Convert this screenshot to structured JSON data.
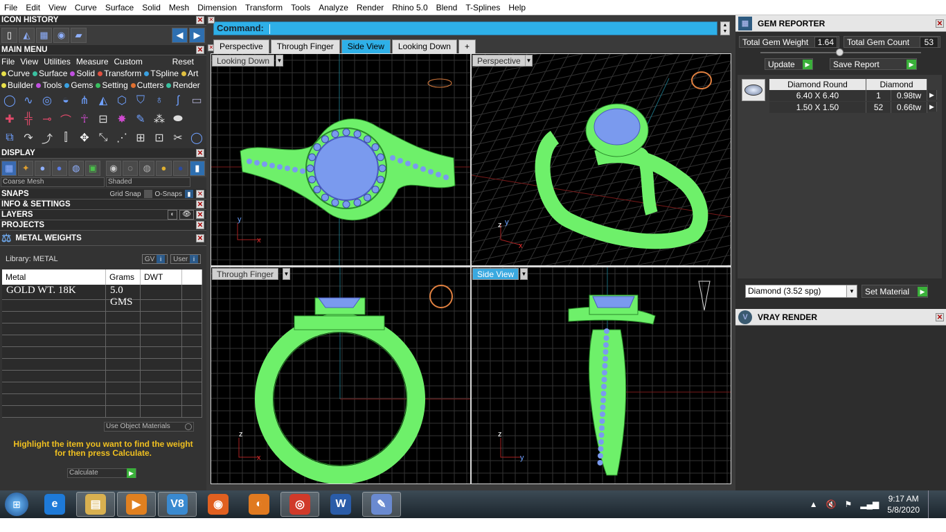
{
  "menubar": [
    "File",
    "Edit",
    "View",
    "Curve",
    "Surface",
    "Solid",
    "Mesh",
    "Dimension",
    "Transform",
    "Tools",
    "Analyze",
    "Render",
    "Rhino 5.0",
    "Blend",
    "T-Splines",
    "Help"
  ],
  "left": {
    "icon_history_title": "ICON HISTORY",
    "main_menu_title": "MAIN MENU",
    "main_menu_items": [
      "File",
      "View",
      "Utilities",
      "Measure",
      "Custom"
    ],
    "reset_label": "Reset",
    "categories_row1": [
      {
        "label": "Curve",
        "color": "#e8e04a"
      },
      {
        "label": "Surface",
        "color": "#3ac0a0"
      },
      {
        "label": "Solid",
        "color": "#c050e0"
      },
      {
        "label": "Transform",
        "color": "#e05040"
      },
      {
        "label": "TSpline",
        "color": "#3aa0e0"
      },
      {
        "label": "Art",
        "color": "#e0c040"
      }
    ],
    "categories_row2": [
      {
        "label": "Builder",
        "color": "#e8e04a"
      },
      {
        "label": "Tools",
        "color": "#c050e0"
      },
      {
        "label": "Gems",
        "color": "#3aa0e0"
      },
      {
        "label": "Setting",
        "color": "#3ac060"
      },
      {
        "label": "Cutters",
        "color": "#e07030"
      },
      {
        "label": "Render",
        "color": "#3ac0a0"
      }
    ],
    "display_title": "DISPLAY",
    "mesh_select": "Coarse Mesh",
    "shade_select": "Shaded",
    "snaps_title": "SNAPS",
    "grid_snap": "Grid Snap",
    "o_snaps": "O-Snaps",
    "info_title": "INFO & SETTINGS",
    "layers_title": "LAYERS",
    "projects_title": "PROJECTS",
    "metal_weights_title": "METAL WEIGHTS",
    "library_label": "Library: METAL",
    "gv_label": "GV",
    "user_label": "User",
    "table_headers": [
      "Metal",
      "Grams",
      "DWT"
    ],
    "rows": [
      {
        "metal": "GOLD WT. 18K",
        "grams": "5.0 GMS",
        "dwt": ""
      }
    ],
    "use_object_materials": "Use Object Materials",
    "hint": "Highlight the item you want to find the weight for then press Calculate.",
    "calculate_label": "Calculate"
  },
  "center": {
    "command_label": "Command:",
    "tabs": [
      "Perspective",
      "Through Finger",
      "Side View",
      "Looking Down"
    ],
    "active_tab": "Side View",
    "add_tab": "+",
    "viewports": {
      "top_left": "Looking Down",
      "top_right": "Perspective",
      "bottom_left": "Through Finger",
      "bottom_right": "Side View"
    },
    "axis_labels": {
      "tl": [
        "y",
        "x"
      ],
      "tr": [
        "z",
        "y",
        "x"
      ],
      "bl": [
        "z",
        "x"
      ],
      "br": [
        "z",
        "y"
      ]
    }
  },
  "right": {
    "gem_reporter_title": "GEM REPORTER",
    "total_gem_weight_label": "Total Gem Weight",
    "total_gem_weight": "1.64",
    "total_gem_count_label": "Total Gem Count",
    "total_gem_count": "53",
    "update_label": "Update",
    "save_report_label": "Save Report",
    "gem_headers": [
      "Diamond Round",
      "Diamond"
    ],
    "gems": [
      {
        "size": "6.40 X 6.40",
        "count": "1",
        "weight": "0.98tw"
      },
      {
        "size": "1.50 X 1.50",
        "count": "52",
        "weight": "0.66tw"
      }
    ],
    "material_select": "Diamond    (3.52 spg)",
    "set_material_label": "Set Material",
    "vray_title": "VRAY RENDER"
  },
  "taskbar": {
    "apps": [
      {
        "name": "ie",
        "color": "#1e7ad8",
        "glyph": "e"
      },
      {
        "name": "explorer",
        "color": "#d8b050",
        "glyph": "▤"
      },
      {
        "name": "media",
        "color": "#e08020",
        "glyph": "▶"
      },
      {
        "name": "v8",
        "color": "#3a8ad0",
        "glyph": "V8"
      },
      {
        "name": "firefox",
        "color": "#e06020",
        "glyph": "◉"
      },
      {
        "name": "blender",
        "color": "#e07a20",
        "glyph": "◐"
      },
      {
        "name": "chrome",
        "color": "#d03a2a",
        "glyph": "◎"
      },
      {
        "name": "word",
        "color": "#2a5ca8",
        "glyph": "W"
      },
      {
        "name": "paint",
        "color": "#6a8ad0",
        "glyph": "✎"
      }
    ],
    "time": "9:17 AM",
    "date": "5/8/2020"
  }
}
